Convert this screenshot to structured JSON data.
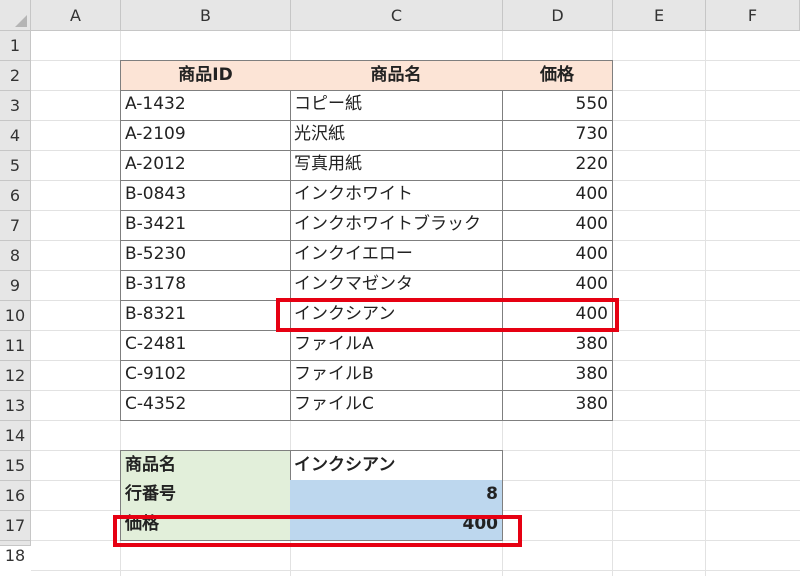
{
  "columns": [
    "A",
    "B",
    "C",
    "D",
    "E",
    "F"
  ],
  "rows": [
    "1",
    "2",
    "3",
    "4",
    "5",
    "6",
    "7",
    "8",
    "9",
    "10",
    "11",
    "12",
    "13",
    "14",
    "15",
    "16",
    "17",
    "18"
  ],
  "table": {
    "headers": [
      "商品ID",
      "商品名",
      "価格"
    ],
    "rows": [
      {
        "id": "A-1432",
        "name": "コピー紙",
        "price": "550"
      },
      {
        "id": "A-2109",
        "name": "光沢紙",
        "price": "730"
      },
      {
        "id": "A-2012",
        "name": "写真用紙",
        "price": "220"
      },
      {
        "id": "B-0843",
        "name": "インクホワイト",
        "price": "400"
      },
      {
        "id": "B-3421",
        "name": "インクホワイトブラック",
        "price": "400"
      },
      {
        "id": "B-5230",
        "name": "インクイエロー",
        "price": "400"
      },
      {
        "id": "B-3178",
        "name": "インクマゼンタ",
        "price": "400"
      },
      {
        "id": "B-8321",
        "name": "インクシアン",
        "price": "400"
      },
      {
        "id": "C-2481",
        "name": "ファイルA",
        "price": "380"
      },
      {
        "id": "C-9102",
        "name": "ファイルB",
        "price": "380"
      },
      {
        "id": "C-4352",
        "name": "ファイルC",
        "price": "380"
      }
    ]
  },
  "lookup": [
    {
      "label": "商品名",
      "value": "インクシアン"
    },
    {
      "label": "行番号",
      "value": "8"
    },
    {
      "label": "価格",
      "value": "400"
    }
  ],
  "colors": {
    "header_fill": "#fce4d6",
    "label_fill": "#e2efda",
    "value_fill": "#bdd7ee",
    "highlight": "#e60012"
  }
}
